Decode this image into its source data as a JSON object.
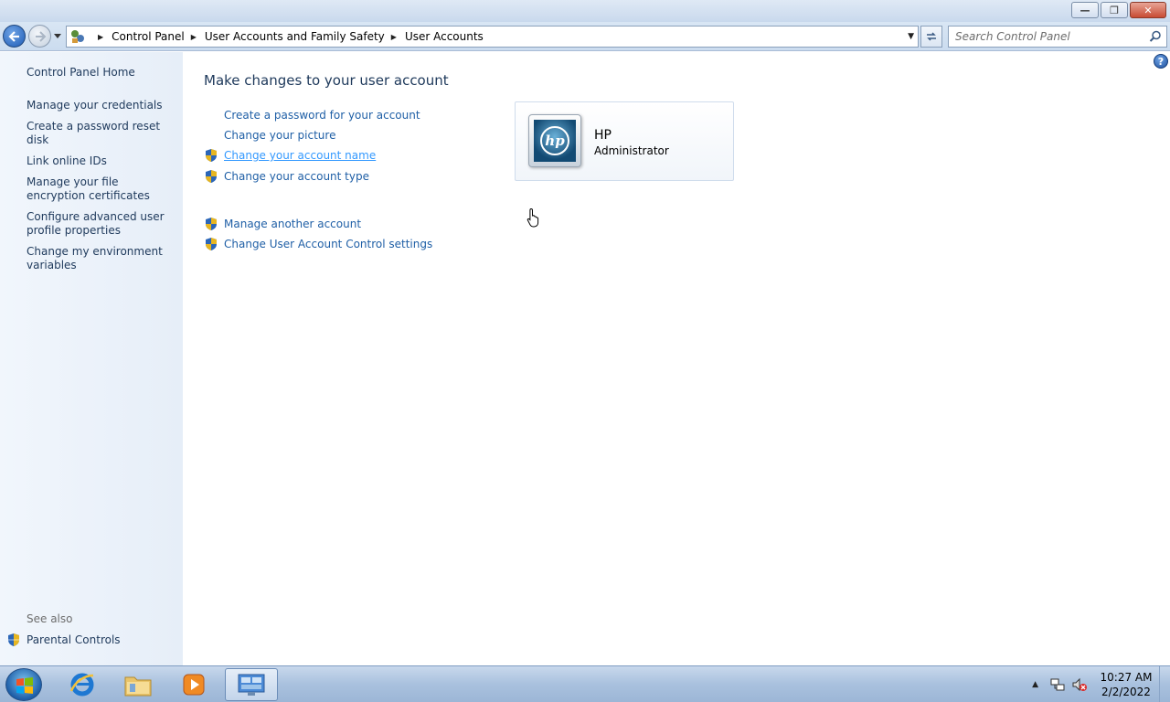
{
  "window": {
    "buttons": {
      "minimize": "minimize-icon",
      "restore": "restore-icon",
      "close": "close-icon"
    }
  },
  "navigation": {
    "breadcrumbs": [
      "Control Panel",
      "User Accounts and Family Safety",
      "User Accounts"
    ],
    "search_placeholder": "Search Control Panel"
  },
  "sidebar": {
    "home": "Control Panel Home",
    "tasks": [
      "Manage your credentials",
      "Create a password reset disk",
      "Link online IDs",
      "Manage your file encryption certificates",
      "Configure advanced user profile properties",
      "Change my environment variables"
    ],
    "see_also_label": "See also",
    "see_also_items": [
      "Parental Controls"
    ]
  },
  "main": {
    "heading": "Make changes to your user account",
    "links": [
      {
        "label": "Create a password for your account",
        "shield": false
      },
      {
        "label": "Change your picture",
        "shield": false
      },
      {
        "label": "Change your account name",
        "shield": true,
        "hovered": true
      },
      {
        "label": "Change your account type",
        "shield": true
      }
    ],
    "other_links": [
      {
        "label": "Manage another account",
        "shield": true
      },
      {
        "label": "Change User Account Control settings",
        "shield": true
      }
    ],
    "account": {
      "name": "HP",
      "role": "Administrator",
      "picture": "hp"
    }
  },
  "taskbar": {
    "pinned": [
      "start-orb",
      "internet-explorer-icon",
      "windows-explorer-icon",
      "media-player-icon",
      "control-panel-icon"
    ],
    "active": "control-panel-icon",
    "clock_time": "10:27 AM",
    "clock_date": "2/2/2022"
  },
  "colors": {
    "link": "#1f5fa6",
    "link_hover": "#3399ff",
    "heading": "#1e395b",
    "sidebar_bg": "#e6eef8"
  }
}
